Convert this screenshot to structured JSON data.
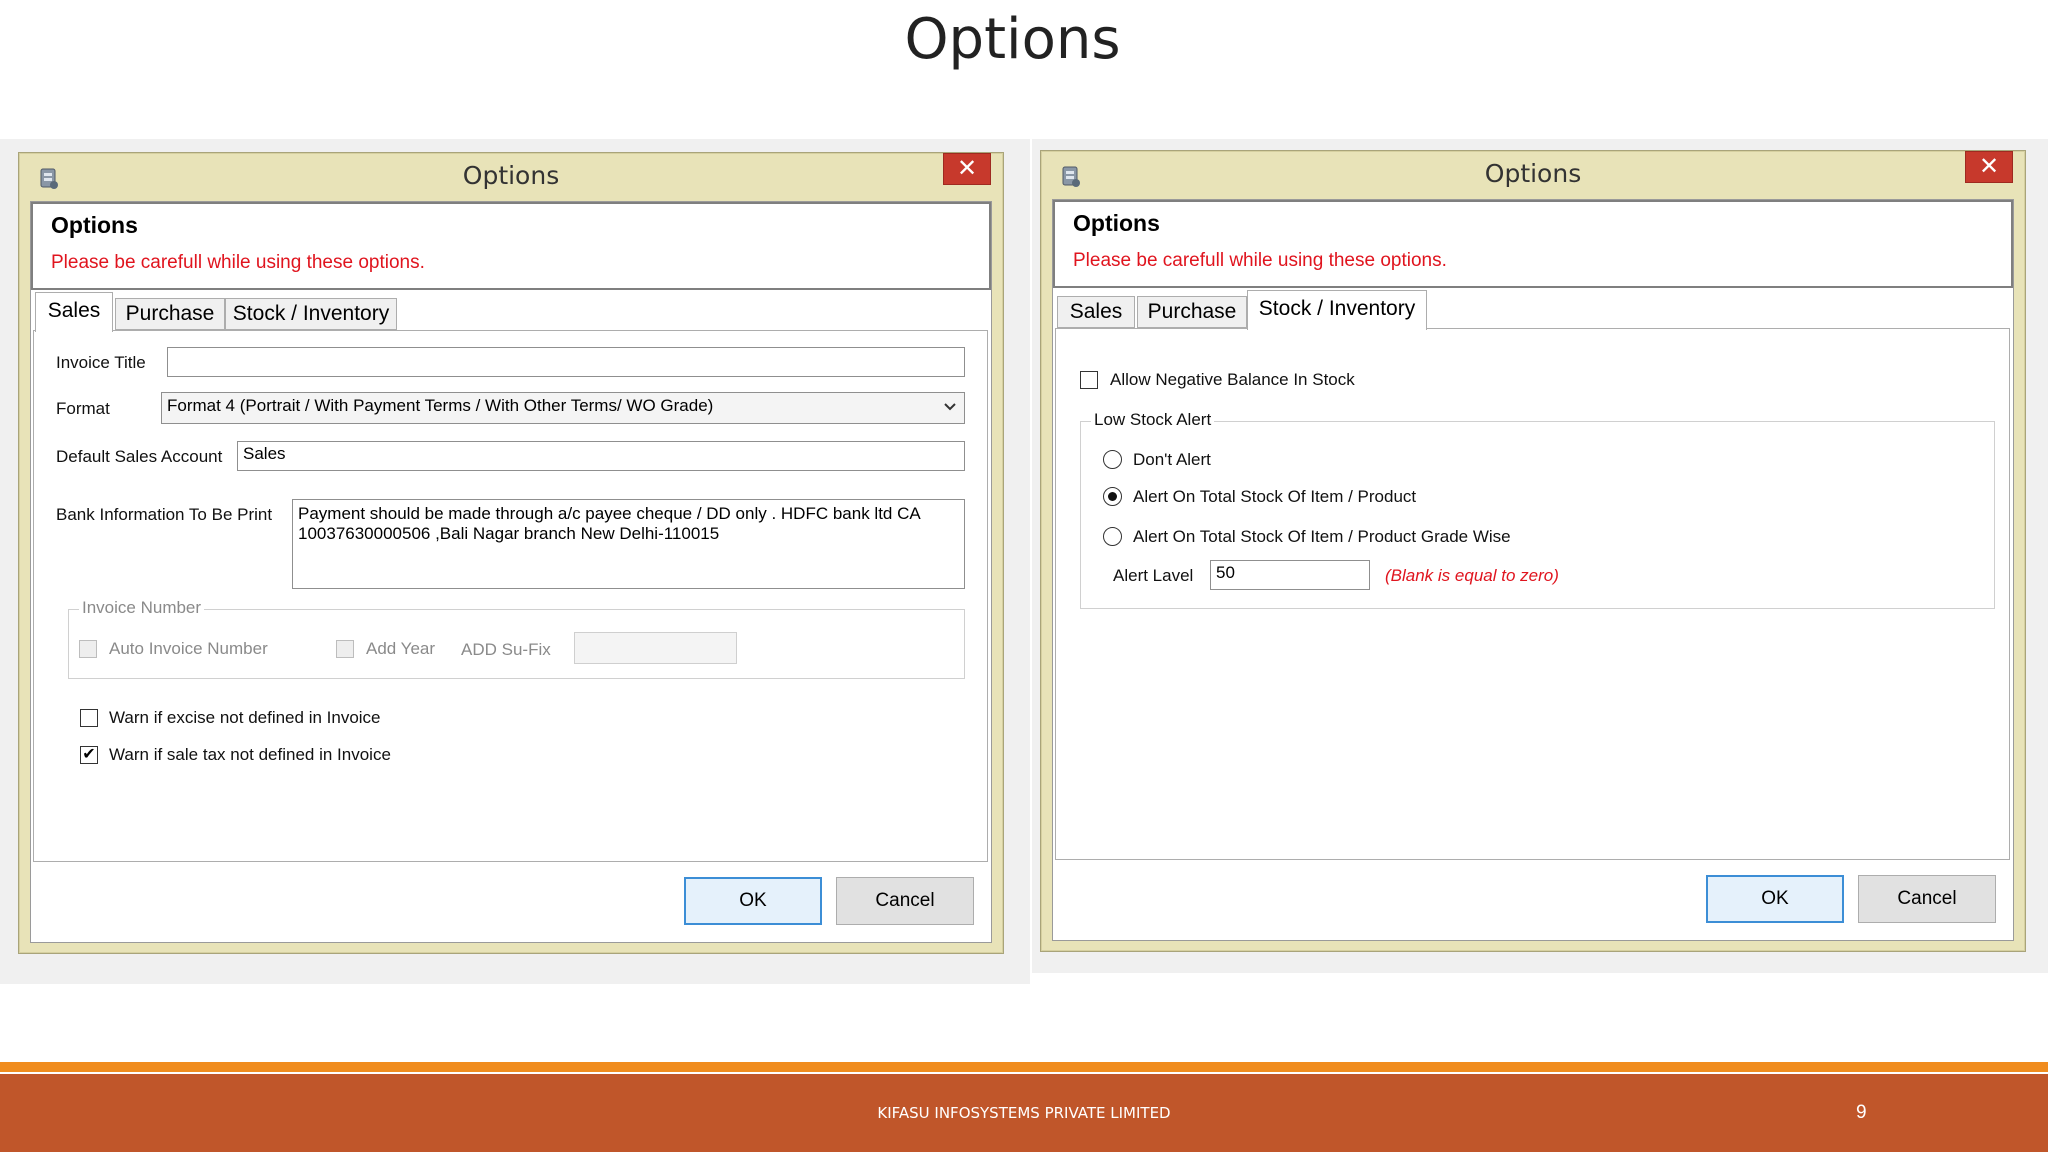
{
  "slide": {
    "title": "Options",
    "footer_company": "KIFASU INFOSYSTEMS PRIVATE LIMITED",
    "page_number": "9"
  },
  "left_dialog": {
    "window_title": "Options",
    "close_glyph": "✕",
    "header_title": "Options",
    "header_warning": "Please be carefull while using these options.",
    "tabs": [
      "Sales",
      "Purchase",
      "Stock / Inventory"
    ],
    "active_tab": "Sales",
    "invoice_title_label": "Invoice Title",
    "invoice_title_value": "",
    "format_label": "Format",
    "format_value": "Format 4 (Portrait / With Payment Terms / With Other Terms/ WO Grade)",
    "default_sales_account_label": "Default Sales Account",
    "default_sales_account_value": "Sales",
    "bank_info_label": "Bank Information To Be Print",
    "bank_info_value": "Payment should be made through a/c payee cheque / DD only . HDFC bank ltd CA 10037630000506 ,Bali Nagar branch New Delhi-110015",
    "invoice_number_group": "Invoice Number",
    "auto_invoice_number_label": "Auto Invoice Number",
    "add_year_label": "Add Year",
    "add_suffix_label": "ADD Su-Fix",
    "add_suffix_value": "",
    "warn_excise_label": "Warn if excise not defined in Invoice",
    "warn_excise_checked": false,
    "warn_sale_tax_label": "Warn if sale tax not defined in Invoice",
    "warn_sale_tax_checked": true,
    "check_glyph": "✔",
    "ok_label": "OK",
    "cancel_label": "Cancel"
  },
  "right_dialog": {
    "window_title": "Options",
    "close_glyph": "✕",
    "header_title": "Options",
    "header_warning": "Please be carefull while using these options.",
    "tabs": [
      "Sales",
      "Purchase",
      "Stock / Inventory"
    ],
    "active_tab": "Stock / Inventory",
    "allow_negative_label": "Allow Negative Balance In Stock",
    "allow_negative_checked": false,
    "low_stock_group": "Low Stock Alert",
    "radio_options": [
      "Don't Alert",
      "Alert On Total Stock Of Item / Product",
      "Alert On Total Stock Of Item / Product Grade Wise"
    ],
    "selected_radio": "Alert On Total Stock Of Item / Product",
    "alert_level_label": "Alert Lavel",
    "alert_level_value": "50",
    "alert_level_hint": "(Blank is equal to zero)",
    "ok_label": "OK",
    "cancel_label": "Cancel"
  },
  "colors": {
    "window_frame": "#e8e3b8",
    "warning_text": "#e0141e",
    "close_button": "#c7392c",
    "footer_bar": "#c0562a",
    "footer_accent": "#f08c1e",
    "default_button_border": "#3c8ed6"
  }
}
